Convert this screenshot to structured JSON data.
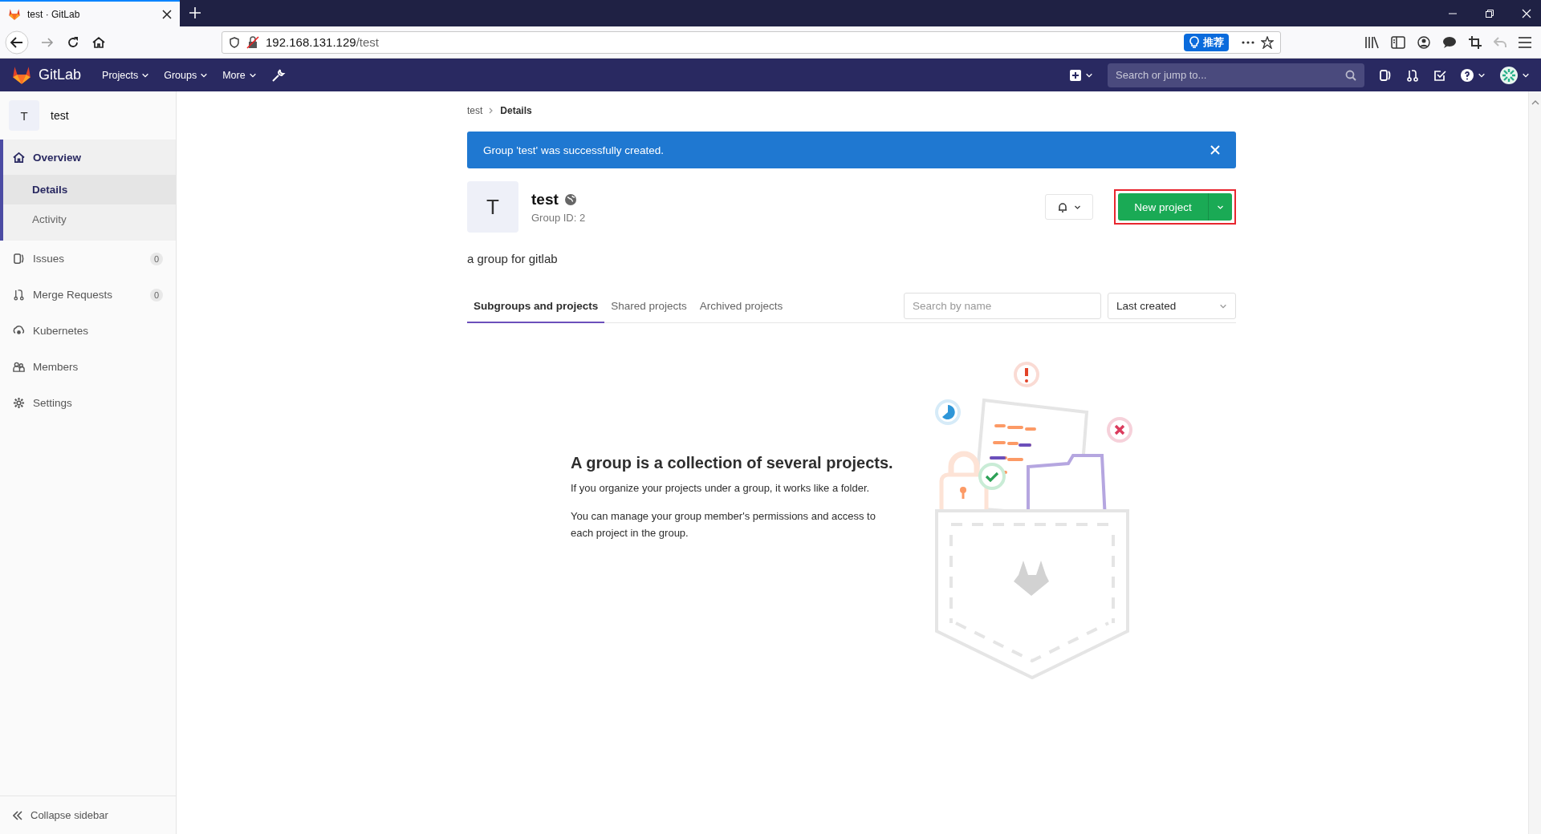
{
  "browser": {
    "tab_title": "test · GitLab",
    "url_host": "192.168.131.129",
    "url_path": "/test",
    "recommend_button": "推荐"
  },
  "navbar": {
    "brand": "GitLab",
    "menus": [
      {
        "label": "Projects"
      },
      {
        "label": "Groups"
      },
      {
        "label": "More"
      }
    ],
    "search_placeholder": "Search or jump to..."
  },
  "sidebar": {
    "group_avatar": "T",
    "group_name": "test",
    "items": [
      {
        "kind": "overview",
        "label": "Overview",
        "selected": true,
        "children": [
          {
            "label": "Details",
            "selected": true
          },
          {
            "label": "Activity",
            "selected": false
          }
        ]
      },
      {
        "kind": "issues",
        "label": "Issues",
        "selected": false,
        "badge": "0"
      },
      {
        "kind": "merge",
        "label": "Merge Requests",
        "selected": false,
        "badge": "0"
      },
      {
        "kind": "kubernetes",
        "label": "Kubernetes",
        "selected": false
      },
      {
        "kind": "members",
        "label": "Members",
        "selected": false
      },
      {
        "kind": "settings",
        "label": "Settings",
        "selected": false
      }
    ],
    "collapse": "Collapse sidebar"
  },
  "breadcrumb": [
    "test",
    "Details"
  ],
  "alert": {
    "message": "Group 'test' was successfully created."
  },
  "group": {
    "avatar": "T",
    "name": "test",
    "id_text": "Group ID: 2",
    "description": "a group for gitlab",
    "new_project_button": "New project",
    "highlighted": true
  },
  "tabs": [
    {
      "label": "Subgroups and projects",
      "selected": true
    },
    {
      "label": "Shared projects",
      "selected": false
    },
    {
      "label": "Archived projects",
      "selected": false
    }
  ],
  "filter": {
    "placeholder": "Search by name",
    "sort": "Last created"
  },
  "empty_state": {
    "title": "A group is a collection of several projects.",
    "paragraphs": [
      "If you organize your projects under a group, it works like a folder.",
      "You can manage your group member's permissions and access to each project in the group."
    ]
  }
}
